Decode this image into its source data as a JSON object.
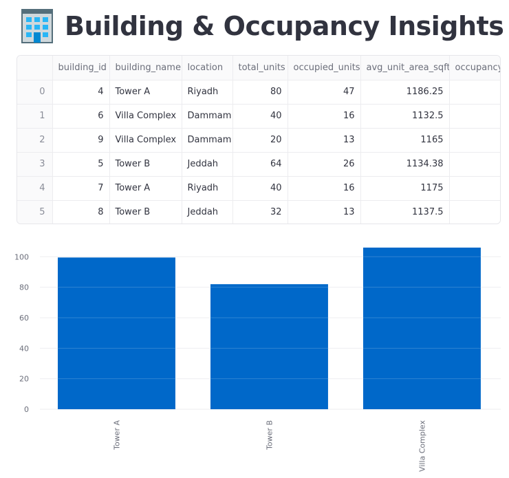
{
  "header": {
    "title": "Building & Occupancy Insights",
    "icon": "office-building-icon"
  },
  "table": {
    "columns": [
      "",
      "building_id",
      "building_name",
      "location",
      "total_units",
      "occupied_units",
      "avg_unit_area_sqft",
      "occupancy_"
    ],
    "rows": [
      {
        "index": "0",
        "building_id": "4",
        "building_name": "Tower A",
        "location": "Riyadh",
        "total_units": "80",
        "occupied_units": "47",
        "avg_unit_area_sqft": "1186.25",
        "occupancy": ""
      },
      {
        "index": "1",
        "building_id": "6",
        "building_name": "Villa Complex",
        "location": "Dammam",
        "total_units": "40",
        "occupied_units": "16",
        "avg_unit_area_sqft": "1132.5",
        "occupancy": ""
      },
      {
        "index": "2",
        "building_id": "9",
        "building_name": "Villa Complex",
        "location": "Dammam",
        "total_units": "20",
        "occupied_units": "13",
        "avg_unit_area_sqft": "1165",
        "occupancy": ""
      },
      {
        "index": "3",
        "building_id": "5",
        "building_name": "Tower B",
        "location": "Jeddah",
        "total_units": "64",
        "occupied_units": "26",
        "avg_unit_area_sqft": "1134.38",
        "occupancy": ""
      },
      {
        "index": "4",
        "building_id": "7",
        "building_name": "Tower A",
        "location": "Riyadh",
        "total_units": "40",
        "occupied_units": "16",
        "avg_unit_area_sqft": "1175",
        "occupancy": ""
      },
      {
        "index": "5",
        "building_id": "8",
        "building_name": "Tower B",
        "location": "Jeddah",
        "total_units": "32",
        "occupied_units": "13",
        "avg_unit_area_sqft": "1137.5",
        "occupancy": ""
      }
    ]
  },
  "chart_data": {
    "type": "bar",
    "categories": [
      "Tower A",
      "Tower B",
      "Villa Complex"
    ],
    "values": [
      99.5,
      82,
      106
    ],
    "yticks": [
      0,
      20,
      40,
      60,
      80,
      100
    ],
    "ylim": [
      0,
      106
    ],
    "grid": true,
    "bar_color": "#0068c9"
  }
}
